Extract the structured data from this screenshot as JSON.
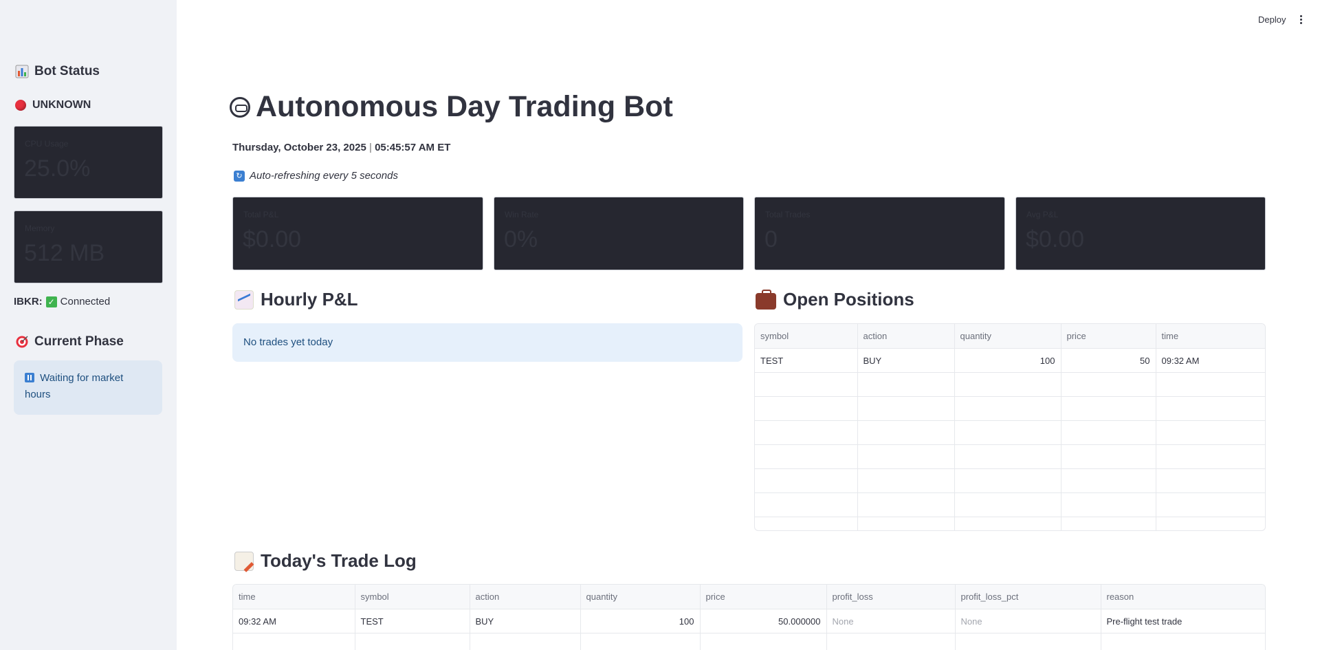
{
  "sidebar": {
    "bot_status_title": "Bot Status",
    "status_text": "UNKNOWN",
    "cpu": {
      "label": "CPU Usage",
      "value": "25.0%"
    },
    "memory": {
      "label": "Memory",
      "value": "512 MB"
    },
    "ibkr_label": "IBKR:",
    "ibkr_status": "Connected",
    "phase_title": "Current Phase",
    "phase_text": "Waiting for market hours"
  },
  "topbar": {
    "deploy_label": "Deploy"
  },
  "main": {
    "title": "Autonomous Day Trading Bot",
    "date": "Thursday, October 23, 2025",
    "separator": "|",
    "time": "05:45:57 AM ET",
    "refresh_text": "Auto-refreshing every 5 seconds",
    "metrics": [
      {
        "label": "Total P&L",
        "value": "$0.00"
      },
      {
        "label": "Win Rate",
        "value": "0%"
      },
      {
        "label": "Total Trades",
        "value": "0"
      },
      {
        "label": "Avg P&L",
        "value": "$0.00"
      }
    ],
    "hourly_title": "Hourly P&L",
    "hourly_empty": "No trades yet today",
    "positions_title": "Open Positions",
    "positions": {
      "columns": [
        "symbol",
        "action",
        "quantity",
        "price",
        "time"
      ],
      "rows": [
        [
          "TEST",
          "BUY",
          "100",
          "50",
          "09:32 AM"
        ]
      ]
    },
    "trade_log_title": "Today's Trade Log",
    "trade_log": {
      "columns": [
        "time",
        "symbol",
        "action",
        "quantity",
        "price",
        "profit_loss",
        "profit_loss_pct",
        "reason"
      ],
      "rows": [
        [
          "09:32 AM",
          "TEST",
          "BUY",
          "100",
          "50.000000",
          "None",
          "None",
          "Pre-flight test trade"
        ]
      ]
    }
  },
  "colors": {
    "sidebar_bg": "#f0f2f6",
    "metric_bg": "#262730",
    "info_bg": "#e6f0fb",
    "info_text": "#1e4f7f"
  }
}
